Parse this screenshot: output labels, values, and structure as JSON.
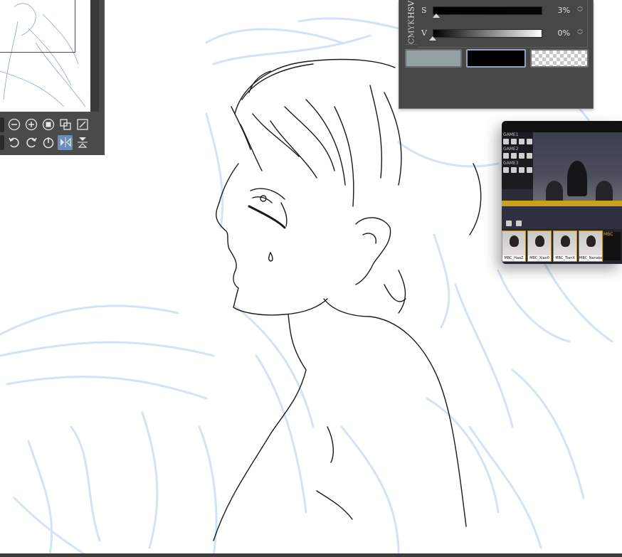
{
  "app": {
    "navigator": {
      "zoom_out_label": "−",
      "zoom_in_label": "+",
      "fit_label": "■"
    },
    "color_slider": {
      "tabs": [
        "HSV",
        "CMYK"
      ],
      "sliders": [
        {
          "label": "S",
          "value": "3%",
          "fraction": 0.03
        },
        {
          "label": "V",
          "value": "0%",
          "fraction": 0.0
        }
      ],
      "swatches": {
        "main_color": "#93a1a4",
        "sub_color": "#000000",
        "transparent": "transparent"
      }
    },
    "stream_overlay": {
      "hud_labels": [
        "GAME1",
        "GAME2",
        "GAME3"
      ],
      "players": [
        "MBC_HaoZ",
        "MBC_Xiao0",
        "MBC_TianX",
        "MBC_Nanake"
      ],
      "logo_text": "MBC"
    },
    "colors": {
      "panel_bg": "#474747",
      "active_button": "#6d8cb8",
      "sketch_blue": "#cfe0f5",
      "ink": "#1a1a1a",
      "nav_frame": "#e01010"
    }
  }
}
